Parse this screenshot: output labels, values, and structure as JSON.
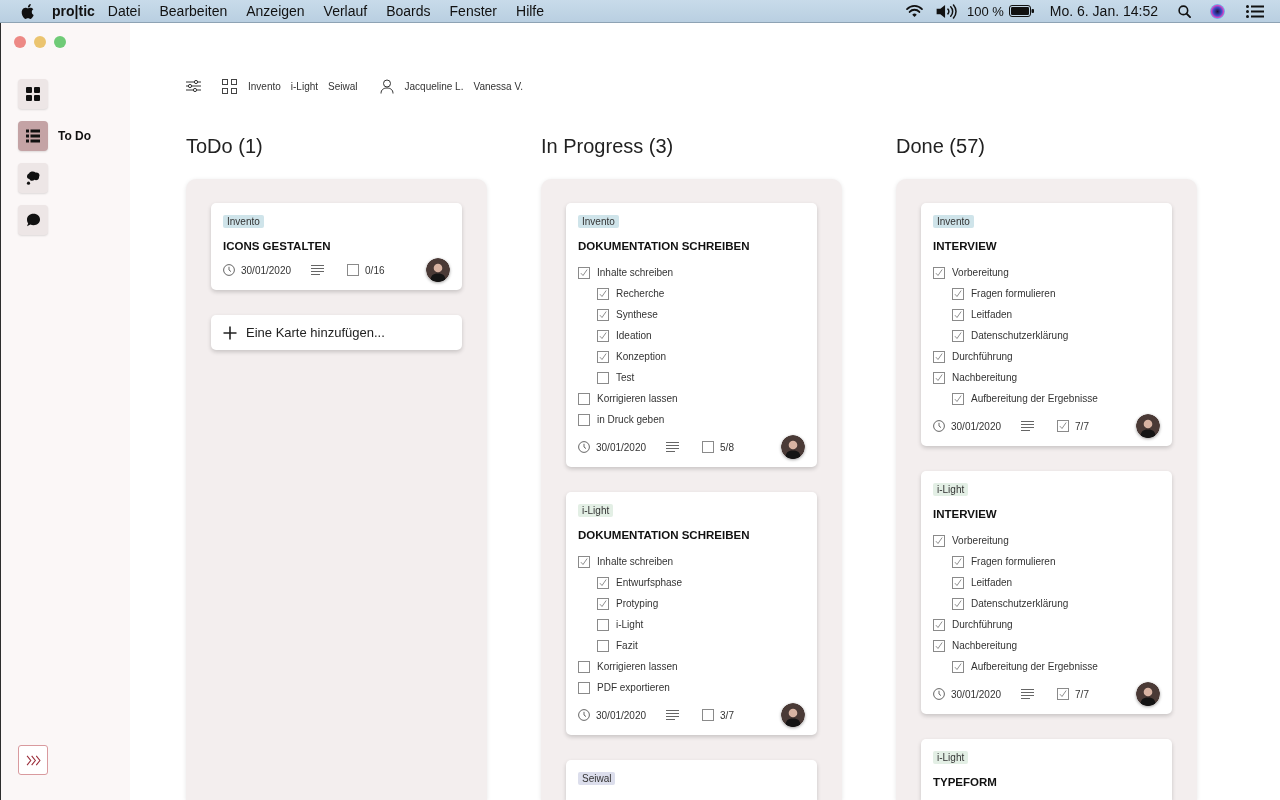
{
  "menu_bar": {
    "app_name": "pro|tic",
    "menus": [
      "Datei",
      "Bearbeiten",
      "Anzeigen",
      "Verlauf",
      "Boards",
      "Fenster",
      "Hilfe"
    ],
    "battery": "100 %",
    "clock": "Mo. 6. Jan. 14:52"
  },
  "sidebar": {
    "items": [
      {
        "kind": "grid",
        "selected": false
      },
      {
        "kind": "list",
        "selected": true,
        "label": "To Do"
      },
      {
        "kind": "thought",
        "selected": false
      },
      {
        "kind": "speech",
        "selected": false
      }
    ]
  },
  "filters": {
    "projects": [
      "Invento",
      "i-Light",
      "Seiwal"
    ],
    "people": [
      "Jacqueline L.",
      "Vanessa V."
    ]
  },
  "columns": [
    {
      "title": "ToDo (1)",
      "cards": [
        {
          "tag": {
            "label": "Invento",
            "color": "#cfe4ea"
          },
          "title": "ICONS GESTALTEN",
          "footer": {
            "date": "30/01/2020",
            "progress": "0/16",
            "checked": false
          }
        }
      ],
      "add_card": "Eine Karte hinzufügen..."
    },
    {
      "title": "In Progress (3)",
      "cards": [
        {
          "tag": {
            "label": "Invento",
            "color": "#cfe4ea"
          },
          "title": "DOKUMENTATION SCHREIBEN",
          "checklist": [
            {
              "text": "Inhalte schreiben",
              "checked": true,
              "children": [
                {
                  "text": "Recherche",
                  "checked": true
                },
                {
                  "text": "Synthese",
                  "checked": true
                },
                {
                  "text": "Ideation",
                  "checked": true
                },
                {
                  "text": "Konzeption",
                  "checked": true
                },
                {
                  "text": "Test",
                  "checked": false
                }
              ]
            },
            {
              "text": "Korrigieren lassen",
              "checked": false
            },
            {
              "text": "in Druck geben",
              "checked": false
            }
          ],
          "footer": {
            "date": "30/01/2020",
            "progress": "5/8",
            "checked": false
          }
        },
        {
          "tag": {
            "label": "i-Light",
            "color": "#e3efe5"
          },
          "title": "DOKUMENTATION SCHREIBEN",
          "checklist": [
            {
              "text": "Inhalte schreiben",
              "checked": true,
              "children": [
                {
                  "text": "Entwurfsphase",
                  "checked": true
                },
                {
                  "text": "Protyping",
                  "checked": true
                },
                {
                  "text": "i-Light",
                  "checked": false
                },
                {
                  "text": "Fazit",
                  "checked": false
                }
              ]
            },
            {
              "text": "Korrigieren lassen",
              "checked": false
            },
            {
              "text": "PDF exportieren",
              "checked": false
            }
          ],
          "footer": {
            "date": "30/01/2020",
            "progress": "3/7",
            "checked": false
          }
        },
        {
          "tag": {
            "label": "Seiwal",
            "color": "#dcdeec"
          }
        }
      ]
    },
    {
      "title": "Done (57)",
      "cards": [
        {
          "tag": {
            "label": "Invento",
            "color": "#cfe4ea"
          },
          "title": "INTERVIEW",
          "checklist": [
            {
              "text": "Vorbereitung",
              "checked": true,
              "children": [
                {
                  "text": "Fragen formulieren",
                  "checked": true
                },
                {
                  "text": "Leitfaden",
                  "checked": true
                },
                {
                  "text": "Datenschutzerklärung",
                  "checked": true
                }
              ]
            },
            {
              "text": "Durchführung",
              "checked": true
            },
            {
              "text": "Nachbereitung",
              "checked": true,
              "children": [
                {
                  "text": "Aufbereitung der Ergebnisse",
                  "checked": true
                }
              ]
            }
          ],
          "footer": {
            "date": "30/01/2020",
            "progress": "7/7",
            "checked": true
          }
        },
        {
          "tag": {
            "label": "i-Light",
            "color": "#e3efe5"
          },
          "title": "INTERVIEW",
          "checklist": [
            {
              "text": "Vorbereitung",
              "checked": true,
              "children": [
                {
                  "text": "Fragen formulieren",
                  "checked": true
                },
                {
                  "text": "Leitfaden",
                  "checked": true
                },
                {
                  "text": "Datenschutzerklärung",
                  "checked": true
                }
              ]
            },
            {
              "text": "Durchführung",
              "checked": true
            },
            {
              "text": "Nachbereitung",
              "checked": true,
              "children": [
                {
                  "text": "Aufbereitung der Ergebnisse",
                  "checked": true
                }
              ]
            }
          ],
          "footer": {
            "date": "30/01/2020",
            "progress": "7/7",
            "checked": true
          }
        },
        {
          "tag": {
            "label": "i-Light",
            "color": "#e3efe5"
          },
          "title": "TYPEFORM"
        }
      ]
    }
  ]
}
